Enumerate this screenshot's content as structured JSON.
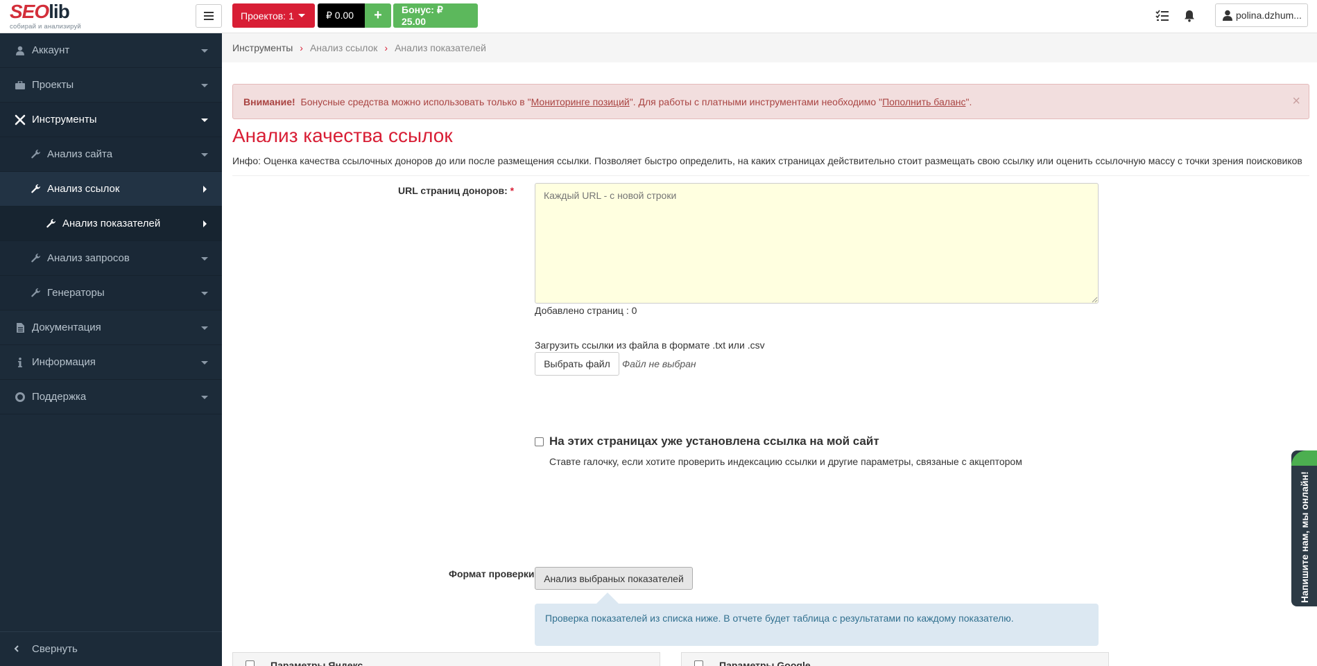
{
  "header": {
    "logo_main_seo": "SEO",
    "logo_main_lib": "lib",
    "logo_sub": "собирай и анализируй",
    "projects_label": "Проектов: 1",
    "balance_label": "₽ 0.00",
    "plus_label": "+",
    "bonus_label": "Бонус: ₽ 25.00",
    "user_label": "polina.dzhum..."
  },
  "sidebar": {
    "items": [
      {
        "label": "Аккаунт"
      },
      {
        "label": "Проекты"
      },
      {
        "label": "Инструменты"
      },
      {
        "label": "Анализ сайта"
      },
      {
        "label": "Анализ ссылок"
      },
      {
        "label": "Анализ показателей"
      },
      {
        "label": "Анализ запросов"
      },
      {
        "label": "Генераторы"
      },
      {
        "label": "Документация"
      },
      {
        "label": "Информация"
      },
      {
        "label": "Поддержка"
      }
    ],
    "collapse_label": "Свернуть"
  },
  "breadcrumb": {
    "items": [
      "Инструменты",
      "Анализ ссылок",
      "Анализ показателей"
    ],
    "separator": "›"
  },
  "alert": {
    "strong": "Внимание!",
    "text1": " Бонусные средства можно использовать только в \"",
    "link1": "Мониторинге позиций",
    "text2": "\". Для работы с платными инструментами необходимо \"",
    "link2": "Пополнить баланс",
    "text3": "\".",
    "close": "×"
  },
  "main": {
    "title": "Анализ качества ссылок",
    "info": "Инфо: Оценка качества ссылочных доноров до или после размещения ссылки. Позволяет быстро определить, на каких страницах действительно стоит размещать свою ссылку или оценить ссылочную массу с точки зрения поисковиков",
    "url_label": "URL страниц доноров:",
    "url_required": "*",
    "url_placeholder": "Каждый URL - с новой строки",
    "added_pages": "Добавлено страниц : 0",
    "upload_label": "Загрузить ссылки из файла в формате .txt или .csv",
    "file_button": "Выбрать файл",
    "file_none": "Файл не выбран",
    "check_label": "На этих страницах уже установлена ссылка на мой сайт",
    "check_help": "Ставте галочку, если хотите проверить индексацию ссылки и другие параметры, связаные с акцептором",
    "format_label": "Формат проверки:",
    "format_button": "Анализ выбраных показателей",
    "format_info": "Проверка показателей из списка ниже. В отчете будет таблица с результатами по каждому показателю.",
    "yandex_params": "Параметры Яндекс",
    "google_params": "Параметры Google"
  },
  "chat": {
    "label": "Напишите нам, мы онлайн!"
  },
  "colors": {
    "accent": "#d81e35",
    "sidebar": "#1c2b39",
    "green": "#5cb85c"
  }
}
